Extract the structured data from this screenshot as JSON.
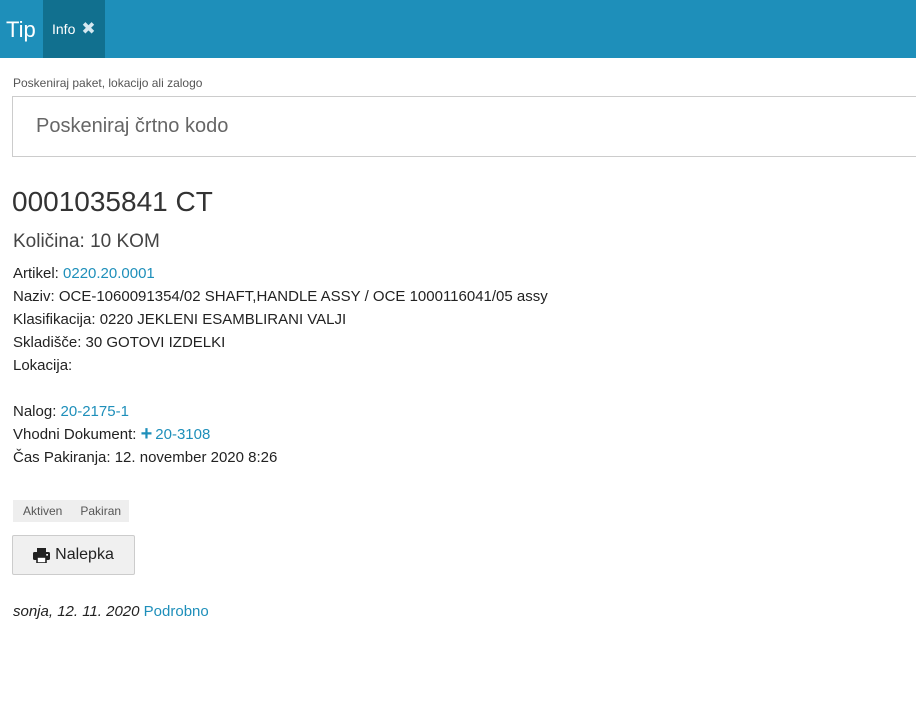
{
  "header": {
    "brand": "Tip",
    "tab_label": "Info",
    "tab_close_icon": "close-icon",
    "background_color": "#1e8fba",
    "active_tab_color": "#11708f"
  },
  "scan": {
    "label": "Poskeniraj paket, lokacijo ali zalogo",
    "placeholder": "Poskeniraj črtno kodo",
    "value": ""
  },
  "package": {
    "title": "0001035841 CT",
    "quantity": "Količina: 10 KOM",
    "article_label": "Artikel: ",
    "article_value": "0220.20.0001",
    "name": "Naziv: OCE-1060091354/02 SHAFT,HANDLE ASSY / OCE 1000116041/05 assy",
    "classification": "Klasifikacija: 0220 JEKLENI ESAMBLIRANI VALJI",
    "warehouse": "Skladišče: 30 GOTOVI IZDELKI",
    "location": "Lokacija:",
    "order_label": "Nalog: ",
    "order_value": "20-2175-1",
    "input_doc_label": "Vhodni Dokument: ",
    "input_doc_icon": "plus-icon",
    "input_doc_value": "20-3108",
    "packing_time": "Čas Pakiranja: 12. november 2020 8:26"
  },
  "statuses": [
    "Aktiven",
    "Pakiran"
  ],
  "actions": {
    "label_button": "Nalepka",
    "label_button_icon": "printer-icon"
  },
  "footer": {
    "meta": "sonja, 12. 11. 2020",
    "details_link": "Podrobno"
  },
  "colors": {
    "link": "#1e8fba"
  }
}
